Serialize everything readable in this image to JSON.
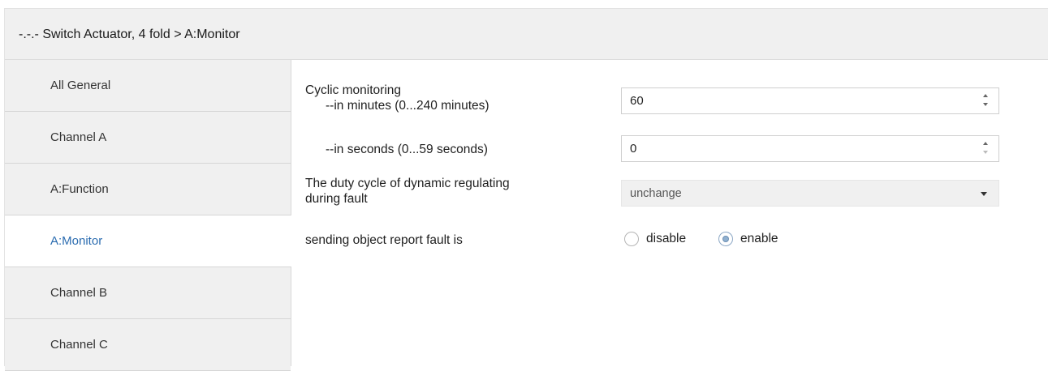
{
  "header": {
    "title": "-.-.- Switch Actuator, 4 fold > A:Monitor"
  },
  "sidebar": {
    "items": [
      {
        "label": "All General"
      },
      {
        "label": "Channel A"
      },
      {
        "label": "A:Function"
      },
      {
        "label": "A:Monitor",
        "active": true
      },
      {
        "label": "Channel B"
      },
      {
        "label": "Channel C"
      }
    ]
  },
  "params": {
    "cyclic_monitoring": {
      "label": "Cyclic monitoring",
      "minutes_label": "--in minutes (0...240 minutes)",
      "minutes_value": "60",
      "seconds_label": "--in seconds (0...59 seconds)",
      "seconds_value": "0"
    },
    "duty_cycle": {
      "label_line1": "The duty cycle of dynamic regulating",
      "label_line2": "during  fault",
      "value": "unchange"
    },
    "report_fault": {
      "label": "sending object report fault is",
      "options": [
        "disable",
        "enable"
      ],
      "selected": "enable"
    }
  },
  "colors": {
    "active_nav": "#2b6cb0",
    "sidebar_bg": "#f0f0f0",
    "header_bg": "#f0f0f0"
  }
}
